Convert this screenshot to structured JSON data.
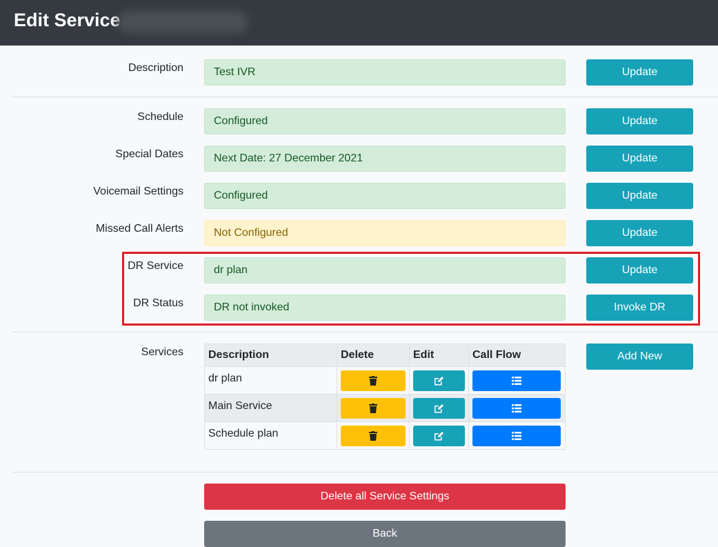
{
  "header": {
    "title": "Edit Service"
  },
  "rows": [
    {
      "label": "Description",
      "value": "Test IVR",
      "button": "Update"
    },
    {
      "label": "Schedule",
      "value": "Configured",
      "button": "Update"
    },
    {
      "label": "Special Dates",
      "value": "Next Date: 27 December 2021",
      "button": "Update"
    },
    {
      "label": "Voicemail Settings",
      "value": "Configured",
      "button": "Update"
    },
    {
      "label": "Missed Call Alerts",
      "value": "Not Configured",
      "button": "Update"
    },
    {
      "label": "DR Service",
      "value": "dr plan",
      "button": "Update"
    },
    {
      "label": "DR Status",
      "value": "DR not invoked",
      "button": "Invoke DR"
    }
  ],
  "services": {
    "label": "Services",
    "add_button": "Add New",
    "columns": [
      "Description",
      "Delete",
      "Edit",
      "Call Flow"
    ],
    "items": [
      {
        "description": "dr plan"
      },
      {
        "description": "Main Service"
      },
      {
        "description": "Schedule plan"
      }
    ]
  },
  "actions": {
    "delete_all": "Delete all Service Settings",
    "back": "Back"
  },
  "colors": {
    "header_bg": "#343a40",
    "success_bg": "#d4edda",
    "warning_bg": "#fff3cd",
    "info": "#17a2b8",
    "primary": "#007bff",
    "warning": "#ffc107",
    "danger": "#dc3545",
    "secondary": "#6c757d",
    "highlight": "#dc1f26"
  },
  "icons": {
    "delete": "trash-icon",
    "edit": "edit-icon",
    "call_flow": "list-icon"
  }
}
